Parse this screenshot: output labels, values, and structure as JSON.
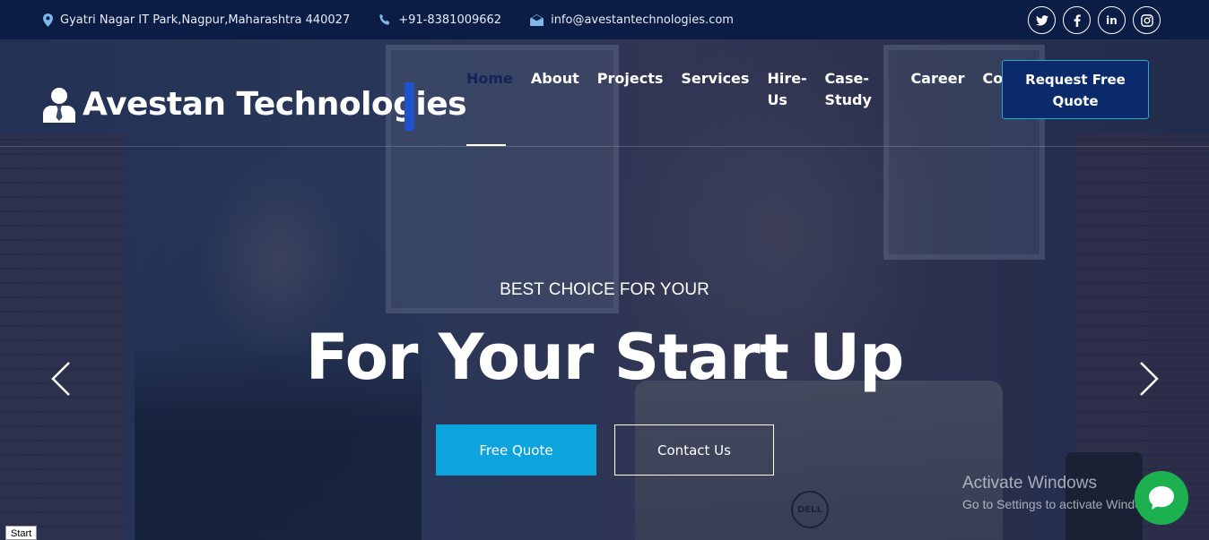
{
  "topbar": {
    "address": "Gyatri Nagar IT Park,Nagpur,Maharashtra 440027",
    "phone": "+91-8381009662",
    "email": "info@avestantechnologies.com",
    "socials": [
      "twitter-icon",
      "facebook-icon",
      "linkedin-icon",
      "instagram-icon"
    ]
  },
  "navbar": {
    "brand": "Avestan Technologies",
    "items": [
      {
        "label": "Home",
        "active": true
      },
      {
        "label": "About"
      },
      {
        "label": "Projects"
      },
      {
        "label": "Services"
      },
      {
        "label": "Hire-Us"
      },
      {
        "label": "Case-Study"
      },
      {
        "label": "Career"
      },
      {
        "label": "Contact"
      }
    ],
    "cta": "Request Free Quote"
  },
  "hero": {
    "kicker": "BEST CHOICE FOR YOUR",
    "headline": "For Your Start Up",
    "primary_button": "Free Quote",
    "secondary_button": "Contact Us",
    "prev_icon": "chevron-left-icon",
    "next_icon": "chevron-right-icon"
  },
  "overlay": {
    "activate_title": "Activate Windows",
    "activate_sub": "Go to Settings to activate Windows.",
    "chat_icon": "chat-bubble-icon",
    "taskbar_start": "Start"
  },
  "colors": {
    "topbar_bg": "#0b1d45",
    "cta_bg": "#0b2a6b",
    "primary_button": "#0da3dd",
    "chat_button": "#1db04f"
  }
}
